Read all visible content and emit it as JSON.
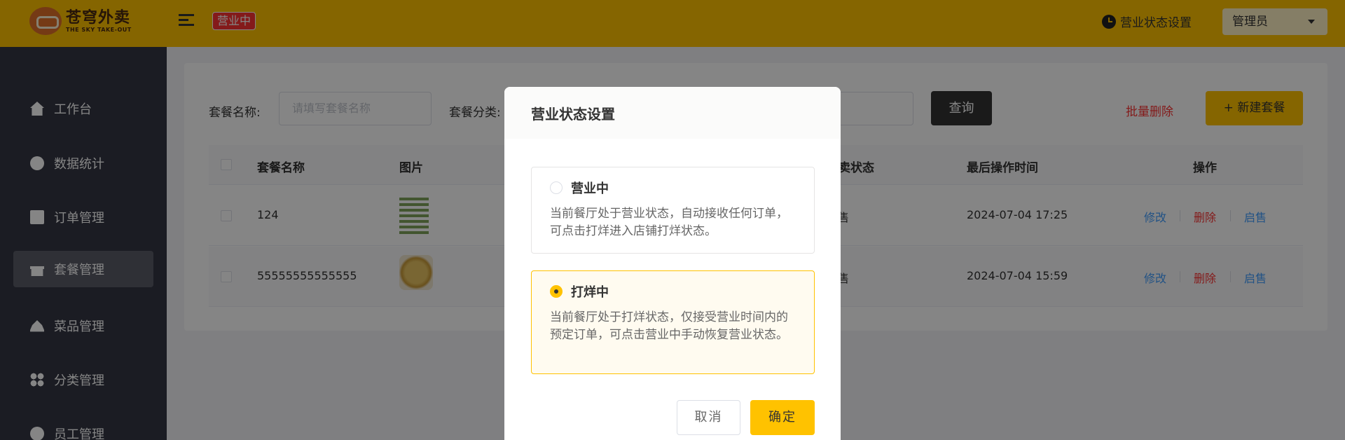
{
  "header": {
    "logo_cn": "苍穹外卖",
    "logo_en": "THE SKY TAKE-OUT",
    "status_tag": "营业中",
    "status_setting": "营业状态设置",
    "user": "管理员"
  },
  "sidebar": {
    "items": [
      {
        "label": "工作台",
        "icon": "home-icon"
      },
      {
        "label": "数据统计",
        "icon": "chart-icon"
      },
      {
        "label": "订单管理",
        "icon": "clipboard-icon"
      },
      {
        "label": "套餐管理",
        "icon": "gift-icon",
        "active": true
      },
      {
        "label": "菜品管理",
        "icon": "cloche-icon"
      },
      {
        "label": "分类管理",
        "icon": "grid-icon"
      },
      {
        "label": "员工管理",
        "icon": "user-icon"
      }
    ]
  },
  "filters": {
    "name_label": "套餐名称:",
    "name_placeholder": "请填写套餐名称",
    "category_label": "套餐分类:",
    "query_label": "查询",
    "batch_delete": "批量删除",
    "new_label": "+ 新建套餐"
  },
  "table": {
    "columns": [
      "套餐名称",
      "图片",
      "售卖状态",
      "最后操作时间",
      "操作"
    ],
    "rows": [
      {
        "name": "124",
        "status": "停售",
        "time": "2024-07-04 17:25"
      },
      {
        "name": "55555555555555",
        "status": "停售",
        "time": "2024-07-04 15:59"
      }
    ],
    "actions": {
      "edit": "修改",
      "delete": "删除",
      "enable": "启售"
    }
  },
  "dialog": {
    "title": "营业状态设置",
    "options": [
      {
        "title": "营业中",
        "desc": "当前餐厅处于营业状态，自动接收任何订单，可点击打烊进入店铺打烊状态。",
        "selected": false
      },
      {
        "title": "打烊中",
        "desc": "当前餐厅处于打烊状态，仅接受营业时间内的预定订单，可点击营业中手动恢复营业状态。",
        "selected": true
      }
    ],
    "cancel": "取消",
    "confirm": "确定"
  },
  "colors": {
    "brand": "#ffc200",
    "danger": "#fd3333",
    "link": "#419eff",
    "sidebar": "#343744"
  }
}
